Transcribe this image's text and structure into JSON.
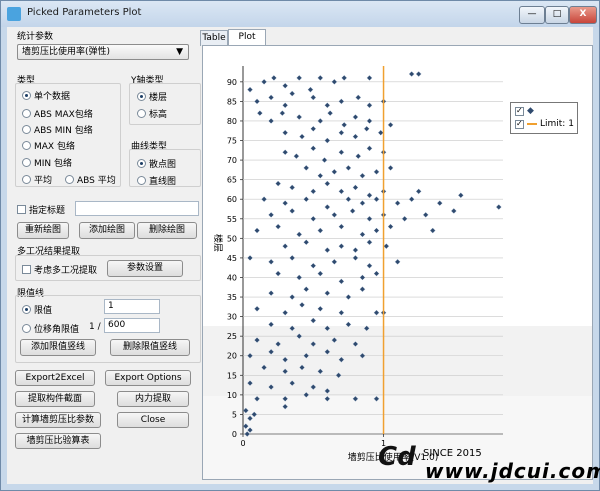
{
  "window": {
    "title": "Picked Parameters Plot",
    "minimize": "—",
    "maximize": "□",
    "close": "X"
  },
  "left": {
    "stat_label": "统计参数",
    "stat_selected": "墙剪压比使用率(弹性)",
    "type_label": "类型",
    "type_options": [
      "单个数据",
      "ABS MAX包络",
      "ABS MIN 包络",
      "MAX 包络",
      "MIN 包络",
      "平均"
    ],
    "type_extra": "ABS 平均",
    "yaxis_label": "Y轴类型",
    "yaxis_options": [
      "楼层",
      "标高"
    ],
    "curve_label": "曲线类型",
    "curve_options": [
      "散点图",
      "直线图"
    ],
    "title_check": "指定标题",
    "btn_redraw": "重新绘图",
    "btn_add": "添加绘图",
    "btn_delete": "删除绘图",
    "multi_label": "多工况结果提取",
    "multi_check": "考虑多工况提取",
    "param_btn": "参数设置",
    "limit_label": "限值线",
    "limit_opt1": "限值",
    "limit_val1": "1",
    "limit_opt2": "位移角限值",
    "limit_prefix": "1 /",
    "limit_val2": "600",
    "btn_add_limit": "添加限值竖线",
    "btn_del_limit": "删除限值竖线",
    "btn_export": "Export2Excel",
    "btn_export_opt": "Export Options",
    "btn_extract_section": "提取构件截面",
    "btn_force": "内力提取",
    "btn_calc": "计算墙剪压比参数",
    "btn_close": "Close",
    "btn_table": "墙剪压比验算表"
  },
  "tabs": [
    "Table",
    "Plot"
  ],
  "legend": {
    "series1": "◆",
    "series2": "Limit: 1"
  },
  "watermark": {
    "since": "SINCE 2015",
    "url": "www.jdcui.com"
  },
  "colors": {
    "limit": "#f0a030",
    "marker": "#2f4a6e"
  },
  "chart_data": {
    "type": "scatter",
    "xlabel": "墙剪压比使用率(V1.0)",
    "ylabel": "楼层",
    "xticks": [
      0,
      1
    ],
    "yticks": [
      0,
      5,
      10,
      15,
      20,
      25,
      30,
      35,
      40,
      45,
      50,
      55,
      60,
      65,
      70,
      75,
      80,
      85,
      90
    ],
    "xlim": [
      0,
      1.85
    ],
    "ylim": [
      0,
      92
    ],
    "limit_x": 1,
    "grid": true,
    "legend": "top-right",
    "points": [
      [
        0.05,
        88
      ],
      [
        0.15,
        90
      ],
      [
        0.22,
        91
      ],
      [
        0.3,
        89
      ],
      [
        0.4,
        91
      ],
      [
        0.48,
        88
      ],
      [
        0.55,
        91
      ],
      [
        0.65,
        90
      ],
      [
        0.72,
        91
      ],
      [
        0.9,
        91
      ],
      [
        1.2,
        92
      ],
      [
        1.25,
        92
      ],
      [
        0.1,
        85
      ],
      [
        0.2,
        86
      ],
      [
        0.3,
        84
      ],
      [
        0.35,
        87
      ],
      [
        0.5,
        86
      ],
      [
        0.6,
        84
      ],
      [
        0.7,
        85
      ],
      [
        0.82,
        86
      ],
      [
        0.9,
        84
      ],
      [
        1.0,
        85
      ],
      [
        0.12,
        82
      ],
      [
        0.2,
        80
      ],
      [
        0.28,
        82
      ],
      [
        0.4,
        81
      ],
      [
        0.55,
        80
      ],
      [
        0.62,
        82
      ],
      [
        0.72,
        79
      ],
      [
        0.8,
        81
      ],
      [
        0.9,
        80
      ],
      [
        0.3,
        77
      ],
      [
        0.42,
        76
      ],
      [
        0.5,
        78
      ],
      [
        0.6,
        75
      ],
      [
        0.7,
        77
      ],
      [
        0.8,
        76
      ],
      [
        0.88,
        78
      ],
      [
        0.98,
        77
      ],
      [
        1.05,
        79
      ],
      [
        0.3,
        72
      ],
      [
        0.38,
        71
      ],
      [
        0.5,
        73
      ],
      [
        0.58,
        70
      ],
      [
        0.7,
        72
      ],
      [
        0.82,
        71
      ],
      [
        0.9,
        73
      ],
      [
        1.0,
        72
      ],
      [
        0.45,
        68
      ],
      [
        0.55,
        66
      ],
      [
        0.65,
        67
      ],
      [
        0.75,
        68
      ],
      [
        0.85,
        66
      ],
      [
        0.95,
        67
      ],
      [
        1.05,
        68
      ],
      [
        0.25,
        64
      ],
      [
        0.35,
        63
      ],
      [
        0.5,
        62
      ],
      [
        0.6,
        64
      ],
      [
        0.7,
        62
      ],
      [
        0.8,
        63
      ],
      [
        0.9,
        61
      ],
      [
        1.0,
        62
      ],
      [
        1.25,
        62
      ],
      [
        0.15,
        60
      ],
      [
        0.3,
        59
      ],
      [
        0.45,
        60
      ],
      [
        0.6,
        58
      ],
      [
        0.75,
        60
      ],
      [
        0.85,
        59
      ],
      [
        0.95,
        60
      ],
      [
        1.1,
        59
      ],
      [
        1.2,
        60
      ],
      [
        1.4,
        59
      ],
      [
        1.55,
        61
      ],
      [
        0.2,
        56
      ],
      [
        0.35,
        57
      ],
      [
        0.5,
        55
      ],
      [
        0.65,
        56
      ],
      [
        0.78,
        57
      ],
      [
        0.9,
        55
      ],
      [
        1.0,
        56
      ],
      [
        1.15,
        55
      ],
      [
        1.3,
        56
      ],
      [
        1.5,
        57
      ],
      [
        1.82,
        58
      ],
      [
        0.1,
        52
      ],
      [
        0.25,
        53
      ],
      [
        0.4,
        51
      ],
      [
        0.55,
        52
      ],
      [
        0.7,
        53
      ],
      [
        0.85,
        51
      ],
      [
        0.95,
        52
      ],
      [
        1.05,
        53
      ],
      [
        1.35,
        52
      ],
      [
        0.3,
        48
      ],
      [
        0.45,
        49
      ],
      [
        0.6,
        47
      ],
      [
        0.7,
        48
      ],
      [
        0.8,
        47
      ],
      [
        0.9,
        49
      ],
      [
        1.02,
        48
      ],
      [
        0.05,
        45
      ],
      [
        0.2,
        44
      ],
      [
        0.35,
        45
      ],
      [
        0.5,
        43
      ],
      [
        0.65,
        44
      ],
      [
        0.8,
        45
      ],
      [
        0.9,
        43
      ],
      [
        1.1,
        44
      ],
      [
        0.25,
        41
      ],
      [
        0.4,
        40
      ],
      [
        0.55,
        41
      ],
      [
        0.7,
        39
      ],
      [
        0.85,
        40
      ],
      [
        0.95,
        41
      ],
      [
        0.2,
        36
      ],
      [
        0.35,
        35
      ],
      [
        0.45,
        37
      ],
      [
        0.6,
        36
      ],
      [
        0.75,
        35
      ],
      [
        0.85,
        37
      ],
      [
        0.1,
        32
      ],
      [
        0.3,
        31
      ],
      [
        0.42,
        33
      ],
      [
        0.55,
        32
      ],
      [
        0.7,
        31
      ],
      [
        0.95,
        31
      ],
      [
        1.0,
        31
      ],
      [
        0.2,
        28
      ],
      [
        0.35,
        27
      ],
      [
        0.5,
        29
      ],
      [
        0.6,
        27
      ],
      [
        0.75,
        28
      ],
      [
        0.88,
        27
      ],
      [
        0.1,
        24
      ],
      [
        0.25,
        23
      ],
      [
        0.4,
        25
      ],
      [
        0.5,
        23
      ],
      [
        0.65,
        24
      ],
      [
        0.8,
        23
      ],
      [
        0.05,
        20
      ],
      [
        0.2,
        21
      ],
      [
        0.3,
        19
      ],
      [
        0.45,
        20
      ],
      [
        0.6,
        21
      ],
      [
        0.7,
        19
      ],
      [
        0.85,
        20
      ],
      [
        0.15,
        17
      ],
      [
        0.3,
        16
      ],
      [
        0.42,
        17
      ],
      [
        0.55,
        16
      ],
      [
        0.68,
        15
      ],
      [
        0.05,
        13
      ],
      [
        0.2,
        12
      ],
      [
        0.35,
        13
      ],
      [
        0.5,
        12
      ],
      [
        0.6,
        11
      ],
      [
        0.1,
        9
      ],
      [
        0.3,
        9
      ],
      [
        0.45,
        10
      ],
      [
        0.6,
        9
      ],
      [
        0.8,
        9
      ],
      [
        0.95,
        9
      ],
      [
        0.02,
        6
      ],
      [
        0.05,
        4
      ],
      [
        0.08,
        5
      ],
      [
        0.02,
        2
      ],
      [
        0.05,
        1
      ],
      [
        0.03,
        0
      ],
      [
        0.3,
        7
      ]
    ]
  }
}
